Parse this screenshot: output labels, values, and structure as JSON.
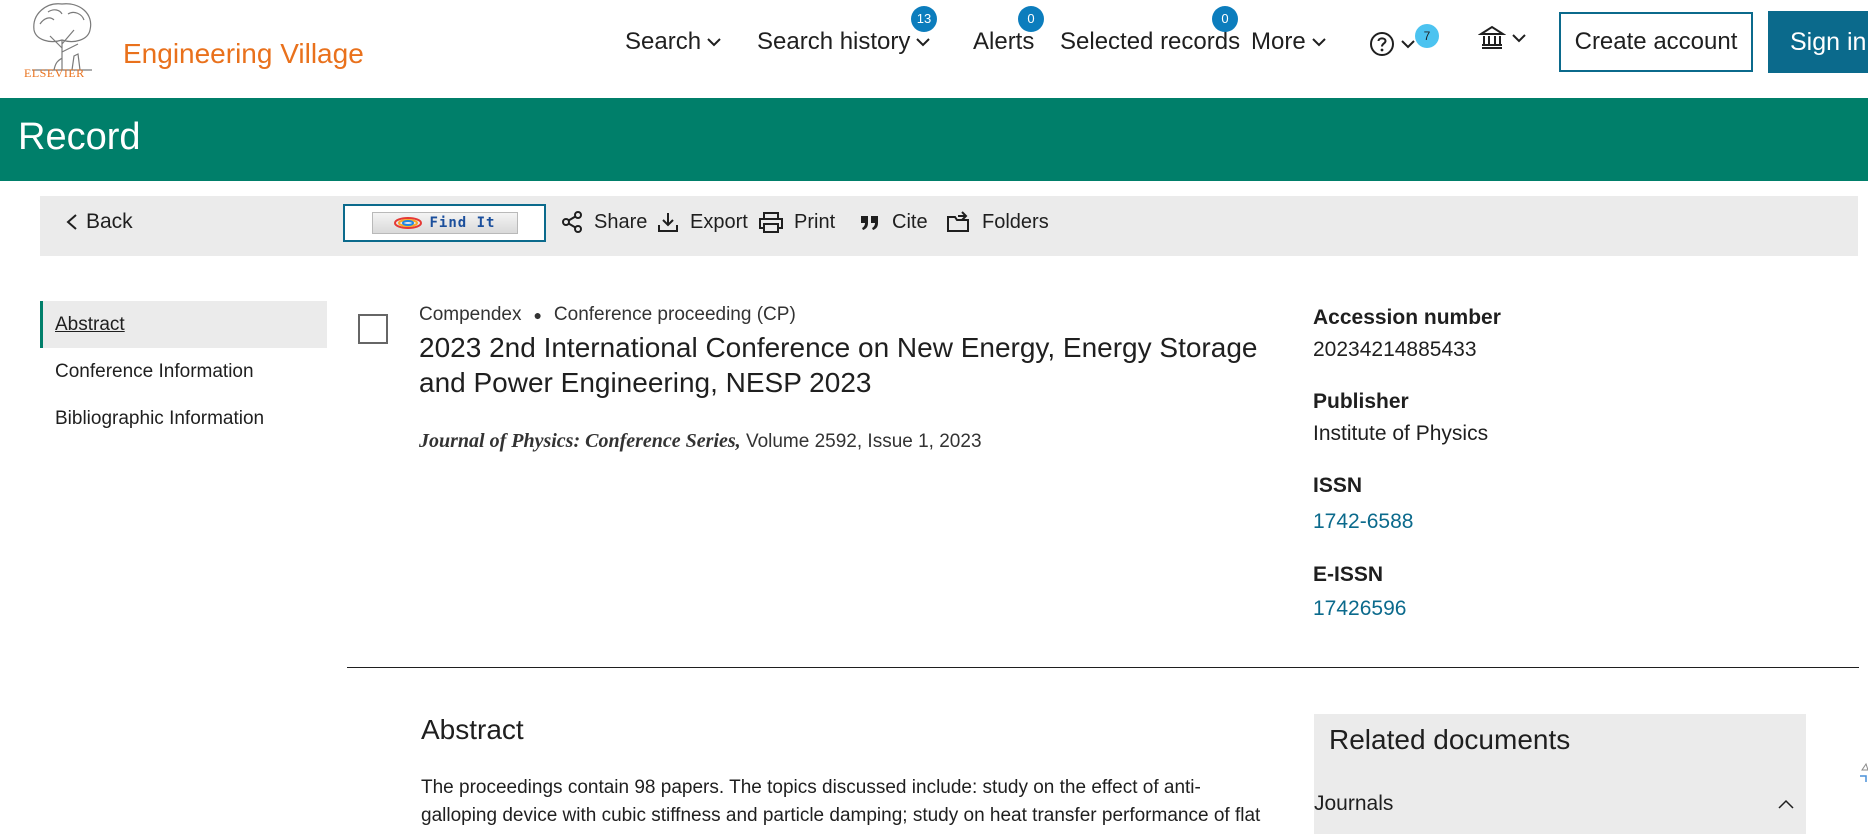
{
  "header": {
    "logo_text": "ELSEVIER",
    "app_title": "Engineering Village",
    "nav": {
      "search": "Search",
      "search_history": "Search history",
      "search_history_count": "13",
      "alerts": "Alerts",
      "alerts_count": "0",
      "selected_records": "Selected records",
      "selected_records_count": "0",
      "more": "More",
      "help_count": "7"
    },
    "create_account": "Create account",
    "sign_in": "Sign in"
  },
  "banner": {
    "title": "Record"
  },
  "toolbar": {
    "back": "Back",
    "find_it": "Find It",
    "share": "Share",
    "export": "Export",
    "print": "Print",
    "cite": "Cite",
    "folders": "Folders"
  },
  "leftnav": {
    "items": [
      "Abstract",
      "Conference Information",
      "Bibliographic Information"
    ]
  },
  "record": {
    "database": "Compendex",
    "doc_type": "Conference proceeding (CP)",
    "title": "2023 2nd International Conference on New Energy, Energy Storage and Power Engineering, NESP 2023",
    "journal": "Journal of Physics: Conference Series,",
    "volume_issue": " Volume 2592, Issue 1, 2023"
  },
  "info": {
    "accession_label": "Accession number",
    "accession_value": "20234214885433",
    "publisher_label": "Publisher",
    "publisher_value": "Institute of Physics",
    "issn_label": "ISSN",
    "issn_value": "1742-6588",
    "eissn_label": "E-ISSN",
    "eissn_value": "17426596"
  },
  "abstract": {
    "heading": "Abstract",
    "text": "The proceedings contain 98 papers. The topics discussed include: study on the effect of anti-galloping device with cubic stiffness and particle damping; study on heat transfer performance of flat plate"
  },
  "related": {
    "heading": "Related documents",
    "journals": "Journals"
  },
  "colors": {
    "brand_orange": "#e9711c",
    "banner_green": "#007f6a",
    "link_blue": "#0b6a8c",
    "badge_blue": "#0c7dbd"
  }
}
